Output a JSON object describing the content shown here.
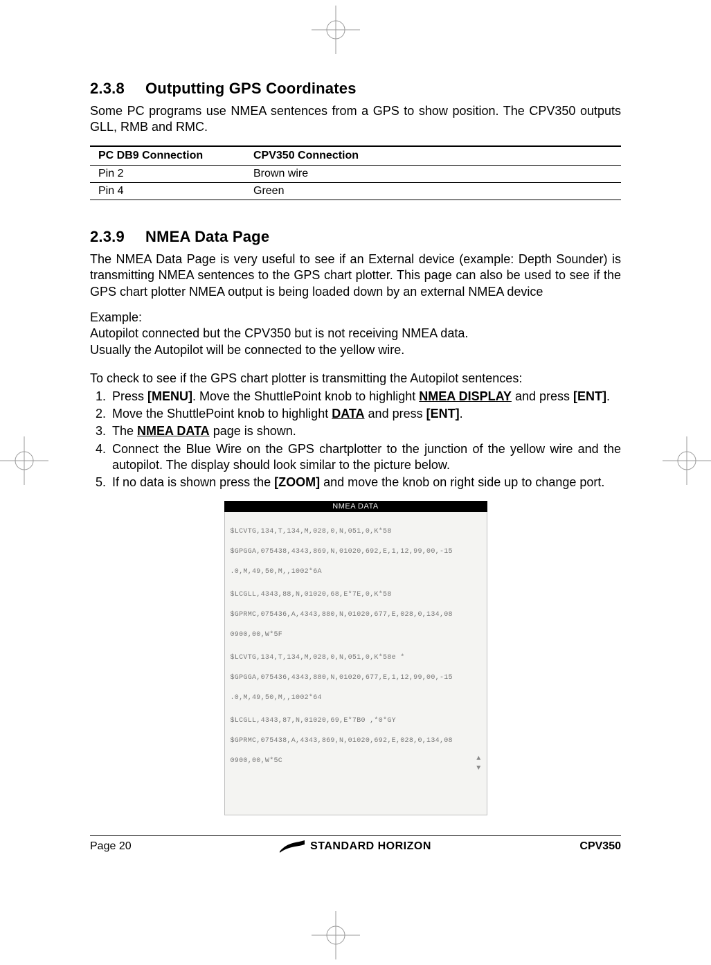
{
  "section_a": {
    "number": "2.3.8",
    "title": "Outputting GPS Coordinates",
    "intro": "Some PC programs use NMEA sentences from a GPS to show position. The CPV350 outputs GLL, RMB and RMC.",
    "table": {
      "head": {
        "c1": "PC DB9 Connection",
        "c2": "CPV350 Connection"
      },
      "rows": [
        {
          "c1": "Pin 2",
          "c2": "Brown wire"
        },
        {
          "c1": "Pin 4",
          "c2": "Green"
        }
      ]
    }
  },
  "section_b": {
    "number": "2.3.9",
    "title": "NMEA Data Page",
    "intro": "The NMEA Data Page is very useful to see if an External device (example: Depth Sounder) is transmitting NMEA sentences to the GPS chart plotter. This page can also be used to see if the GPS chart plotter NMEA output is being loaded down by an external NMEA device",
    "example_label": "Example:",
    "example_l1": "Autopilot connected but the CPV350 but is not receiving NMEA data.",
    "example_l2": "Usually the Autopilot will be connected to the yellow wire.",
    "steps_intro": "To check to see if the GPS chart plotter is transmitting the Autopilot sentences:",
    "steps": {
      "s1a": "Press ",
      "s1b": "[MENU]",
      "s1c": ". Move the ShuttlePoint knob to highlight ",
      "s1d": "NMEA DISPLAY",
      "s1e": " and press ",
      "s1f": "[ENT]",
      "s1g": ".",
      "s2a": "Move the ShuttlePoint knob to highlight ",
      "s2b": "DATA",
      "s2c": " and press ",
      "s2d": "[ENT]",
      "s2e": ".",
      "s3a": "The ",
      "s3b": "NMEA DATA",
      "s3c": " page is shown.",
      "s4": "Connect the Blue Wire on the GPS chartplotter to the junction of the yellow wire and the autopilot. The display should look similar to the picture below.",
      "s5a": "If no data is shown press the  ",
      "s5b": "[ZOOM]",
      "s5c": " and move the knob on right side up to change port."
    },
    "nmea_panel": {
      "title": "NMEA DATA",
      "lines": [
        "$LCVTG,134,T,134,M,028,0,N,051,0,K*58",
        "$GPGGA,075438,4343,869,N,01020,692,E,1,12,99,00,-15",
        ".0,M,49,50,M,,1002*6A",
        "$LCGLL,4343,88,N,01020,68,E*7E,0,K*58",
        "$GPRMC,075436,A,4343,880,N,01020,677,E,028,0,134,08",
        "0900,00,W*5F",
        "$LCVTG,134,T,134,M,028,0,N,051,0,K*58e  *",
        "$GPGGA,075436,4343,880,N,01020,677,E,1,12,99,00,-15",
        ".0,M,49,50,M,,1002*64",
        "$LCGLL,4343,87,N,01020,69,E*7B0  ,*0*GY",
        "$GPRMC,075438,A,4343,869,N,01020,692,E,028,0,134,08",
        "0900,00,W*5C"
      ]
    }
  },
  "footer": {
    "page": "Page 20",
    "brand": "STANDARD HORIZON",
    "model": "CPV350"
  }
}
